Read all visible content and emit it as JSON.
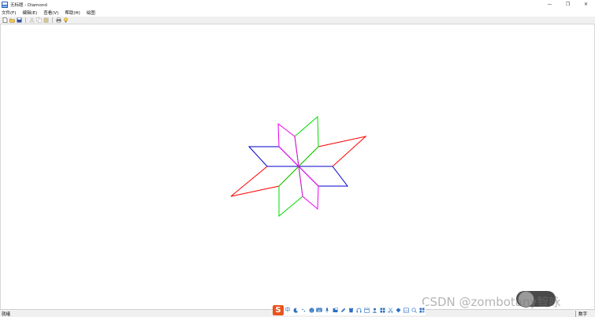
{
  "window": {
    "title": "无标题 - Diamond",
    "minimize_glyph": "—",
    "restore_glyph": "❐",
    "close_glyph": "✕"
  },
  "menu": [
    {
      "label": "文件(F)"
    },
    {
      "label": "编辑(E)"
    },
    {
      "label": "查看(V)"
    },
    {
      "label": "帮助(H)"
    },
    {
      "label": "绘图"
    }
  ],
  "toolbar": {
    "buttons": [
      "new-icon",
      "open-icon",
      "save-icon",
      "cut-icon",
      "copy-icon",
      "paste-icon",
      "print-icon",
      "about-icon"
    ]
  },
  "drawing": {
    "name": "Diamond",
    "colors": {
      "red": "#ff0000",
      "blue": "#0000cc",
      "green": "#00dd00",
      "magenta": "#ee00ee"
    }
  },
  "status": {
    "ready": "就绪",
    "num": "数字"
  },
  "ime": {
    "logo": "S",
    "mode": "中"
  },
  "watermark": {
    "text": "CSDN @zombotany智咏"
  }
}
